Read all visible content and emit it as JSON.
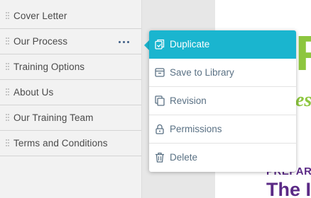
{
  "sections": [
    {
      "label": "Cover Letter"
    },
    {
      "label": "Our Process"
    },
    {
      "label": "Training Options"
    },
    {
      "label": "About Us"
    },
    {
      "label": "Our Training Team"
    },
    {
      "label": "Terms and Conditions"
    }
  ],
  "context_menu": {
    "items": [
      {
        "label": "Duplicate",
        "icon": "duplicate-icon",
        "highlighted": true
      },
      {
        "label": "Save to Library",
        "icon": "library-icon"
      },
      {
        "label": "Revision",
        "icon": "revision-icon"
      },
      {
        "label": "Permissions",
        "icon": "lock-icon"
      },
      {
        "label": "Delete",
        "icon": "trash-icon"
      }
    ]
  },
  "document_preview": {
    "heading_fragment": "P",
    "italic_fragment": "es",
    "preparing_fragment": "PREPAR",
    "title_fragment": "The I"
  },
  "colors": {
    "accent": "#1ab5cf",
    "green": "#8dc63f",
    "purple": "#5b2a86",
    "dots": "#3f5f86"
  }
}
